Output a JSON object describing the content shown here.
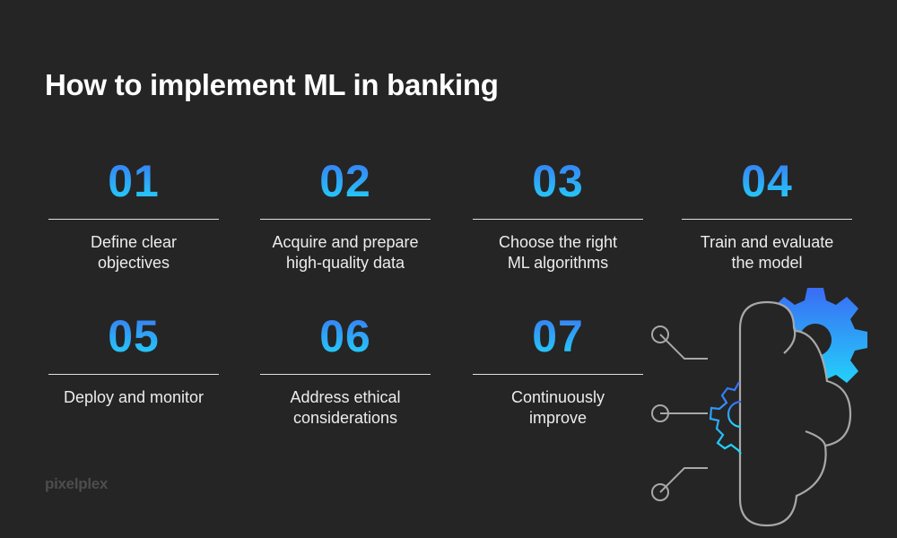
{
  "header": {
    "title": "How to implement ML in banking"
  },
  "steps": [
    {
      "number": "01",
      "label": "Define clear\nobjectives"
    },
    {
      "number": "02",
      "label": "Acquire and prepare\nhigh-quality data"
    },
    {
      "number": "03",
      "label": "Choose the right\nML algorithms"
    },
    {
      "number": "04",
      "label": "Train and evaluate\nthe model"
    },
    {
      "number": "05",
      "label": "Deploy and monitor"
    },
    {
      "number": "06",
      "label": "Address ethical\nconsiderations"
    },
    {
      "number": "07",
      "label": "Continuously\nimprove"
    }
  ],
  "footer": {
    "brand": "pixelplex"
  },
  "colors": {
    "background": "#252525",
    "accent_top": "#3a78f2",
    "accent_bottom": "#22d4fa",
    "line": "#a8a8a8"
  },
  "illustration": {
    "icon": "brain-gears-icon"
  }
}
